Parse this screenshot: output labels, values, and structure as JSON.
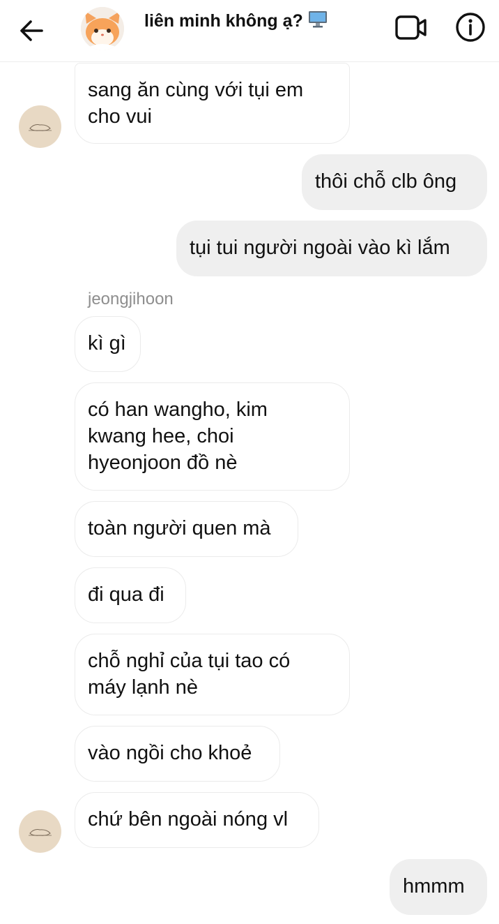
{
  "header": {
    "title": "liên minh không ạ?",
    "back_icon": "arrow-left-icon",
    "video_icon": "video-camera-icon",
    "info_icon": "info-icon"
  },
  "sender_name": "jeongjihoon",
  "messages": [
    {
      "direction": "incoming",
      "text": "sang ăn cùng với tụi em\ncho vui"
    },
    {
      "direction": "outgoing",
      "text": "thôi chỗ clb ông"
    },
    {
      "direction": "outgoing",
      "text": "tụi tui người ngoài vào kì lắm"
    },
    {
      "direction": "incoming",
      "text": "kì gì"
    },
    {
      "direction": "incoming",
      "text": "có han wangho, kim\nkwang hee, choi\nhyeonjoon đồ nè"
    },
    {
      "direction": "incoming",
      "text": "toàn người quen mà"
    },
    {
      "direction": "incoming",
      "text": "đi qua đi"
    },
    {
      "direction": "incoming",
      "text": "chỗ nghỉ của tụi tao có\nmáy lạnh nè"
    },
    {
      "direction": "incoming",
      "text": "vào ngồi cho khoẻ"
    },
    {
      "direction": "incoming",
      "text": "chứ bên ngoài nóng vl"
    },
    {
      "direction": "outgoing",
      "text": "hmmm"
    }
  ],
  "colors": {
    "outgoing_bubble": "#efefef",
    "incoming_border": "#ebebeb",
    "avatar_bg": "#e8d9c4",
    "sender_name": "#8e8e8e"
  }
}
